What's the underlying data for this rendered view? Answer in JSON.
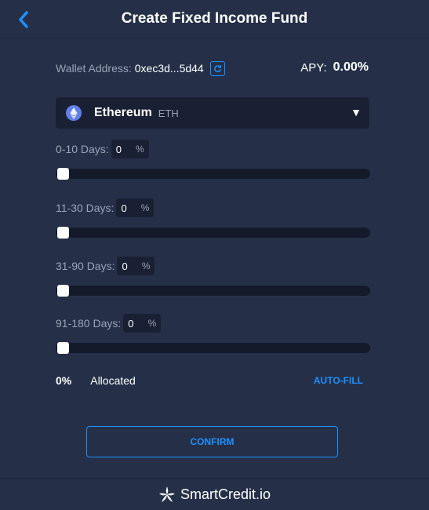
{
  "header": {
    "title": "Create Fixed Income Fund"
  },
  "wallet": {
    "label": "Wallet Address:",
    "address": "0xec3d...5d44"
  },
  "apy": {
    "label": "APY:",
    "value": "0.00%"
  },
  "token": {
    "name": "Ethereum",
    "symbol": "ETH",
    "caret": "▼"
  },
  "ranges": [
    {
      "label": "0-10 Days:",
      "value": "0",
      "unit": "%",
      "slider_fraction": 0
    },
    {
      "label": "11-30 Days:",
      "value": "0",
      "unit": "%",
      "slider_fraction": 0
    },
    {
      "label": "31-90 Days:",
      "value": "0",
      "unit": "%",
      "slider_fraction": 0
    },
    {
      "label": "91-180 Days:",
      "value": "0",
      "unit": "%",
      "slider_fraction": 0
    }
  ],
  "allocation": {
    "percent": "0%",
    "label": "Allocated",
    "autofill": "AUTO-FILL"
  },
  "confirm_label": "CONFIRM",
  "footer": {
    "brand": "SmartCredit.io"
  },
  "colors": {
    "accent": "#1e90ff",
    "background": "#253048",
    "panel": "#1a2034",
    "eth": "#627eea"
  }
}
